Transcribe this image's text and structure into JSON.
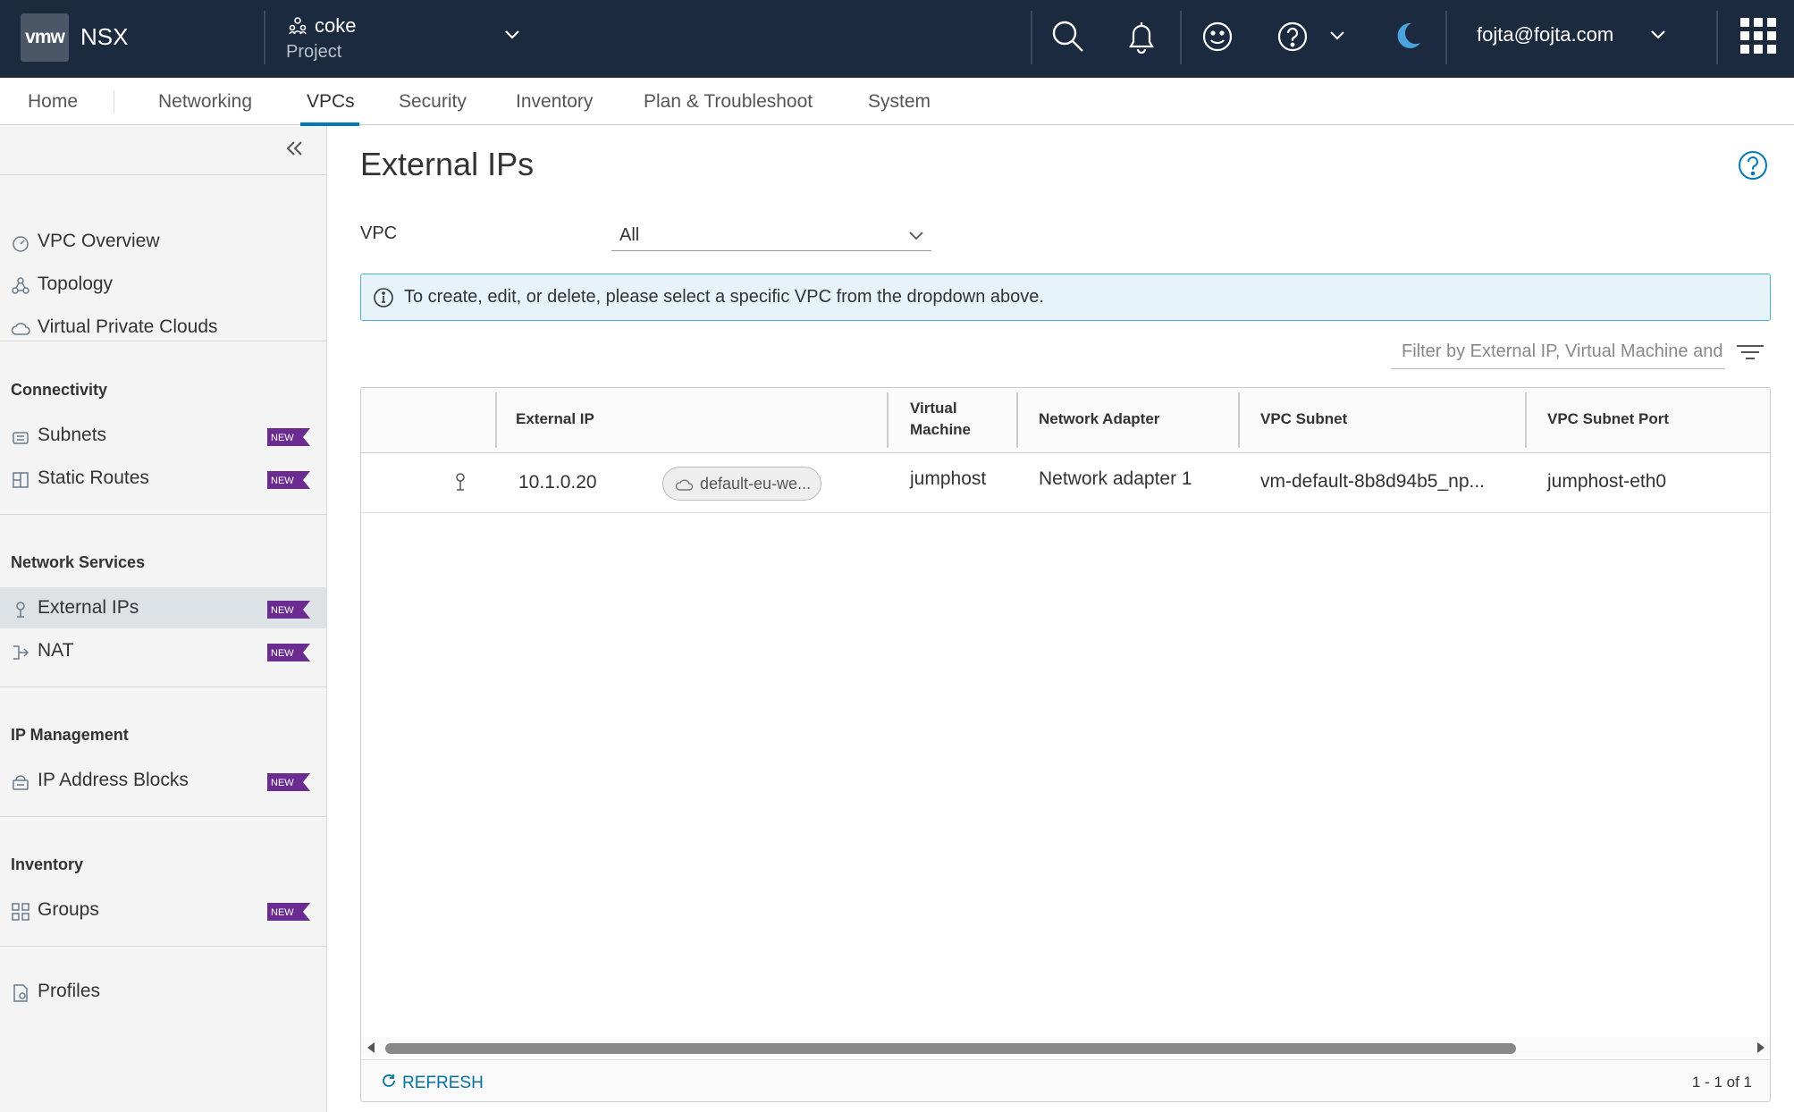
{
  "header": {
    "logo": "vmw",
    "app_name": "NSX",
    "project_name": "coke",
    "project_label": "Project",
    "user": "fojta@fojta.com"
  },
  "topnav": {
    "tabs": [
      {
        "label": "Home"
      },
      {
        "label": "Networking"
      },
      {
        "label": "VPCs",
        "active": true
      },
      {
        "label": "Security"
      },
      {
        "label": "Inventory"
      },
      {
        "label": "Plan & Troubleshoot"
      },
      {
        "label": "System"
      }
    ]
  },
  "sidebar": {
    "top_items": [
      {
        "label": "VPC Overview",
        "icon": "gauge-icon"
      },
      {
        "label": "Topology",
        "icon": "topology-icon"
      },
      {
        "label": "Virtual Private Clouds",
        "icon": "cloud-icon"
      }
    ],
    "sections": [
      {
        "title": "Connectivity",
        "items": [
          {
            "label": "Subnets",
            "icon": "subnet-icon",
            "badge": "NEW"
          },
          {
            "label": "Static Routes",
            "icon": "route-icon",
            "badge": "NEW"
          }
        ]
      },
      {
        "title": "Network Services",
        "items": [
          {
            "label": "External IPs",
            "icon": "location-pin-icon",
            "badge": "NEW",
            "active": true
          },
          {
            "label": "NAT",
            "icon": "nat-icon",
            "badge": "NEW"
          }
        ]
      },
      {
        "title": "IP Management",
        "items": [
          {
            "label": "IP Address Blocks",
            "icon": "ip-block-icon",
            "badge": "NEW"
          }
        ]
      },
      {
        "title": "Inventory",
        "items": [
          {
            "label": "Groups",
            "icon": "groups-icon",
            "badge": "NEW"
          }
        ]
      }
    ],
    "bottom_items": [
      {
        "label": "Profiles",
        "icon": "profile-doc-icon"
      }
    ]
  },
  "main": {
    "title": "External IPs",
    "vpc_filter_label": "VPC",
    "vpc_selected": "All",
    "alert_text": "To create, edit, or delete, please select a specific VPC from the dropdown above.",
    "filter_placeholder": "Filter by External IP, Virtual Machine and more"
  },
  "table": {
    "columns": [
      "External IP",
      "Virtual Machine",
      "Network Adapter",
      "VPC Subnet",
      "VPC Subnet Port"
    ],
    "rows": [
      {
        "external_ip": "10.1.0.20",
        "vpc_tag": "default-eu-we...",
        "virtual_machine": "jumphost",
        "network_adapter": "Network adapter 1",
        "vpc_subnet": "vm-default-8b8d94b5_np...",
        "vpc_subnet_port": "jumphost-eth0"
      }
    ],
    "refresh_label": "REFRESH",
    "pagination": "1 - 1 of 1"
  },
  "colors": {
    "header_bg": "#1b2a3f",
    "accent": "#0079b8",
    "new_badge": "#6b2c91",
    "active_item_bg": "#dde2e7"
  }
}
